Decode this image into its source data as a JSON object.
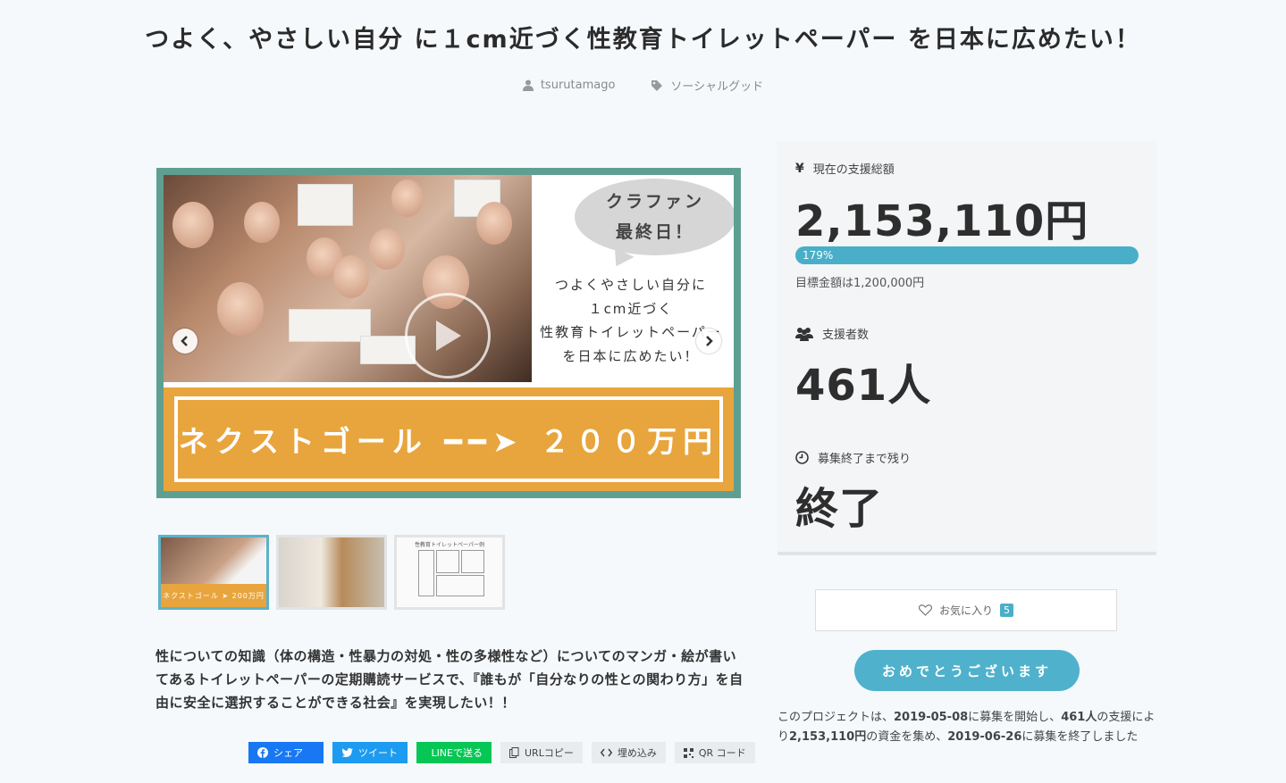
{
  "project": {
    "title": "つよく、やさしい自分 に１cm近づく性教育トイレットペーパー を日本に広めたい！",
    "author": "tsurutamago",
    "category": "ソーシャルグッド"
  },
  "hero": {
    "bubble_line1": "クラファン",
    "bubble_line2": "最終日！",
    "side_line1": "つよくやさしい自分に",
    "side_line2": "１cm近づく",
    "side_line3": "性教育トイレットペーパー",
    "side_line4": "を日本に広めたい！",
    "banner_text": "ネクストゴール ━━➤ ２００万円"
  },
  "thumbnails": [
    {
      "caption": "ネクストゴール ➤ 200万円"
    },
    {
      "caption": ""
    },
    {
      "caption": "性教育トイレットペーパー例"
    }
  ],
  "description": "性についての知識（体の構造・性暴力の対処・性の多様性など）についてのマンガ・絵が書いてあるトイレットペーパーの定期購読サービスで、『誰もが「自分なりの性との関わり方」を自由に安全に選択することができる社会』を実現したい！！",
  "share": {
    "facebook": "シェア",
    "twitter": "ツイート",
    "line": "LINEで送る",
    "url_copy": "URLコピー",
    "embed": "埋め込み",
    "qr": "QR コード"
  },
  "stats": {
    "amount_label": "現在の支援総額",
    "amount": "2,153,110円",
    "progress_text": "179%",
    "progress_fraction": 1.79,
    "goal_text": "目標金額は1,200,000円",
    "backers_label": "支援者数",
    "backers": "461人",
    "remaining_label": "募集終了まで残り",
    "remaining": "終了"
  },
  "favorite": {
    "label": "お気に入り",
    "count": "5"
  },
  "congrats_button": "おめでとうございます",
  "summary": {
    "p1": "このプロジェクトは、",
    "start": "2019-05-08",
    "p2": "に募集を開始し、",
    "backers": "461人",
    "p3": "の支援により",
    "amount": "2,153,110円",
    "p4": "の資金を集め、",
    "end": "2019-06-26",
    "p5": "に募集を終了しました"
  },
  "colors": {
    "accent": "#49afc9",
    "banner": "#e8a53d",
    "frame": "#5f9f91"
  }
}
